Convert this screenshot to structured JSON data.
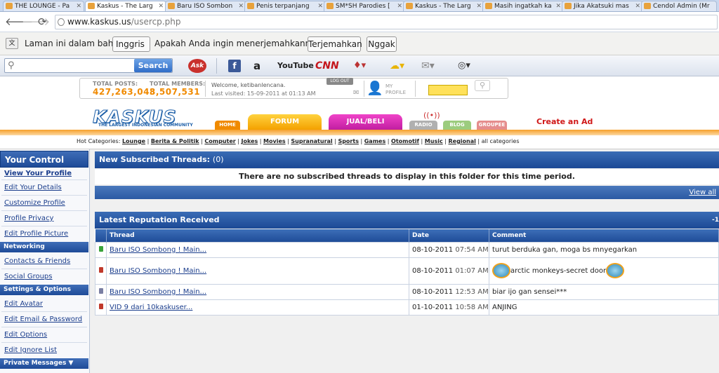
{
  "browser": {
    "tabs": [
      {
        "label": "THE LOUNGE - Pa"
      },
      {
        "label": "Kaskus - The Larg"
      },
      {
        "label": "Baru ISO Sombon"
      },
      {
        "label": "Penis terpanjang"
      },
      {
        "label": "SM*SH Parodies ["
      },
      {
        "label": "Kaskus - The Larg"
      },
      {
        "label": "Masih ingatkah ka"
      },
      {
        "label": "Jika Akatsuki mas"
      },
      {
        "label": "Cendol Admin (Mr"
      }
    ],
    "url_domain": "www.kaskus.us",
    "url_path": "/usercp.php"
  },
  "translate_bar": {
    "text1": "Laman ini dalam bahasa",
    "language": "Inggris",
    "text2": "Apakah Anda ingin menerjemahkannya?",
    "translate_button": "Terjemahkan",
    "no_button": "Nggak"
  },
  "toolbar": {
    "search_button": "Search",
    "ask_label": "Ask",
    "youtube_label": "YouTube",
    "cnn_label": "CNN"
  },
  "info": {
    "total_posts_label": "TOTAL POSTS:",
    "total_posts": "427,263,048",
    "total_members_label": "TOTAL MEMBERS:",
    "total_members": "3,507,531",
    "welcome": "Welcome, ketibanlencana.",
    "last_visited": "Last visited: 15-09-2011 at 01:13 AM",
    "logout": "LOG OUT",
    "my_profile": "MY PROFILE"
  },
  "site": {
    "logo": "KASKUS",
    "tagline": "THE LARGEST INDONESIAN COMMUNITY",
    "nav": {
      "home": "HOME",
      "forum": "FORUM",
      "jualbeli": "JUAL/BELI",
      "radio": "RADIO",
      "blog": "BLOG",
      "groupee": "GROUPEE"
    },
    "create_ad": "Create an Ad"
  },
  "hot_categories": {
    "label": "Hot Categories:",
    "items": [
      "Lounge",
      "Berita & Politik",
      "Computer",
      "Jokes",
      "Movies",
      "Supranatural",
      "Sports",
      "Games",
      "Otomotif",
      "Music",
      "Regional"
    ],
    "all": "all categories"
  },
  "sidebar": {
    "title": "Your Control Panel",
    "links1": [
      "View Your Profile",
      "Edit Your Details",
      "Customize Profile",
      "Profile Privacy",
      "Edit Profile Picture"
    ],
    "section_networking": "Networking",
    "links2": [
      "Contacts & Friends",
      "Social Groups"
    ],
    "section_settings": "Settings & Options",
    "links3": [
      "Edit Avatar",
      "Edit Email & Password",
      "Edit Options",
      "Edit Ignore List"
    ],
    "section_pm": "Private Messages ▼"
  },
  "subscribed": {
    "title": "New Subscribed Threads:",
    "count": "(0)",
    "message": "There are no subscribed threads to display in this folder for this time period.",
    "view_all": "View all"
  },
  "reputation": {
    "title": "Latest Reputation Received",
    "collapse": "-1",
    "headers": [
      "Thread",
      "Date",
      "Comment"
    ],
    "rows": [
      {
        "color": "#3aa33a",
        "thread": "Baru ISO Sombong ! Main...",
        "date": "08-10-2011",
        "time": "07:54 AM",
        "comment": "turut berduka gan, moga bs mnyegarkan"
      },
      {
        "color": "#c0392b",
        "thread": "Baru ISO Sombong ! Main...",
        "date": "08-10-2011",
        "time": "01:07 AM",
        "comment": "arctic monkeys-secret door"
      },
      {
        "color": "#7a7fa3",
        "thread": "Baru ISO Sombong ! Main...",
        "date": "08-10-2011",
        "time": "12:53 AM",
        "comment": "biar ijo gan sensei***"
      },
      {
        "color": "#c0392b",
        "thread": "VID 9 dari 10kaskuser...",
        "date": "01-10-2011",
        "time": "10:58 AM",
        "comment": "ANJING"
      }
    ]
  }
}
